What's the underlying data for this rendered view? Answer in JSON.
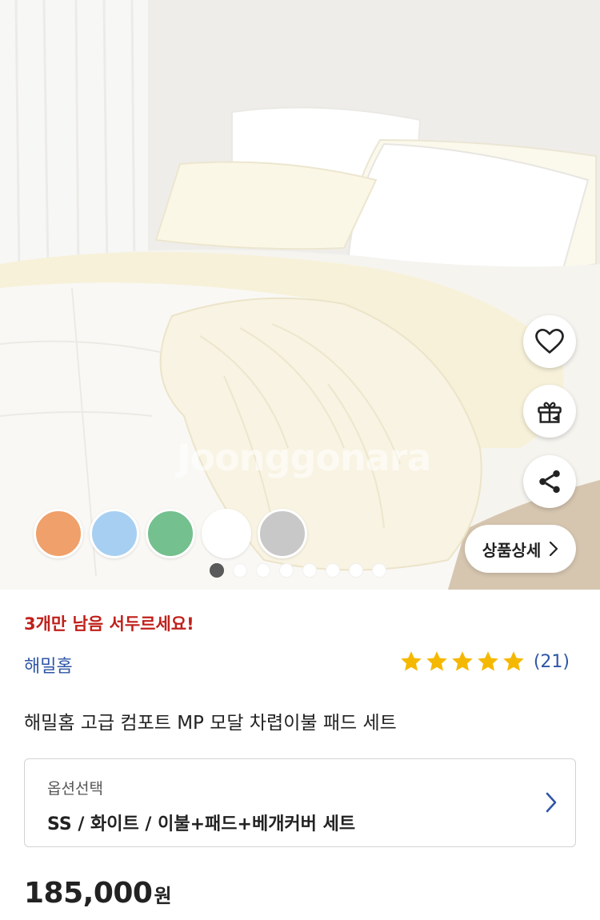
{
  "hero": {
    "watermark": "Joonggonara",
    "detail_button_label": "상품상세",
    "icons": [
      "heart-icon",
      "gift-icon",
      "share-icon",
      "chevron-right-icon"
    ],
    "swatches": [
      {
        "name": "orange",
        "color": "#f0a06a"
      },
      {
        "name": "blue",
        "color": "#a7cff2"
      },
      {
        "name": "green",
        "color": "#74c08e"
      },
      {
        "name": "white",
        "color": "#ffffff"
      },
      {
        "name": "gray",
        "color": "#c8c8c8"
      }
    ],
    "carousel": {
      "total": 8,
      "active_index": 1
    }
  },
  "product": {
    "urgency": "3개만 남음 서두르세요!",
    "brand": "해밀홈",
    "rating_stars": 5,
    "rating_count": "(21)",
    "title": "해밀홈 고급 컴포트 MP 모달 차렵이불 패드 세트",
    "option": {
      "label": "옵션선택",
      "value": "SS / 화이트 / 이불+패드+베개커버 세트"
    },
    "price": "185,000",
    "price_unit": "원"
  },
  "colors": {
    "urgency": "#c0201a",
    "link_blue": "#2f56a6",
    "star": "#f5b800"
  }
}
